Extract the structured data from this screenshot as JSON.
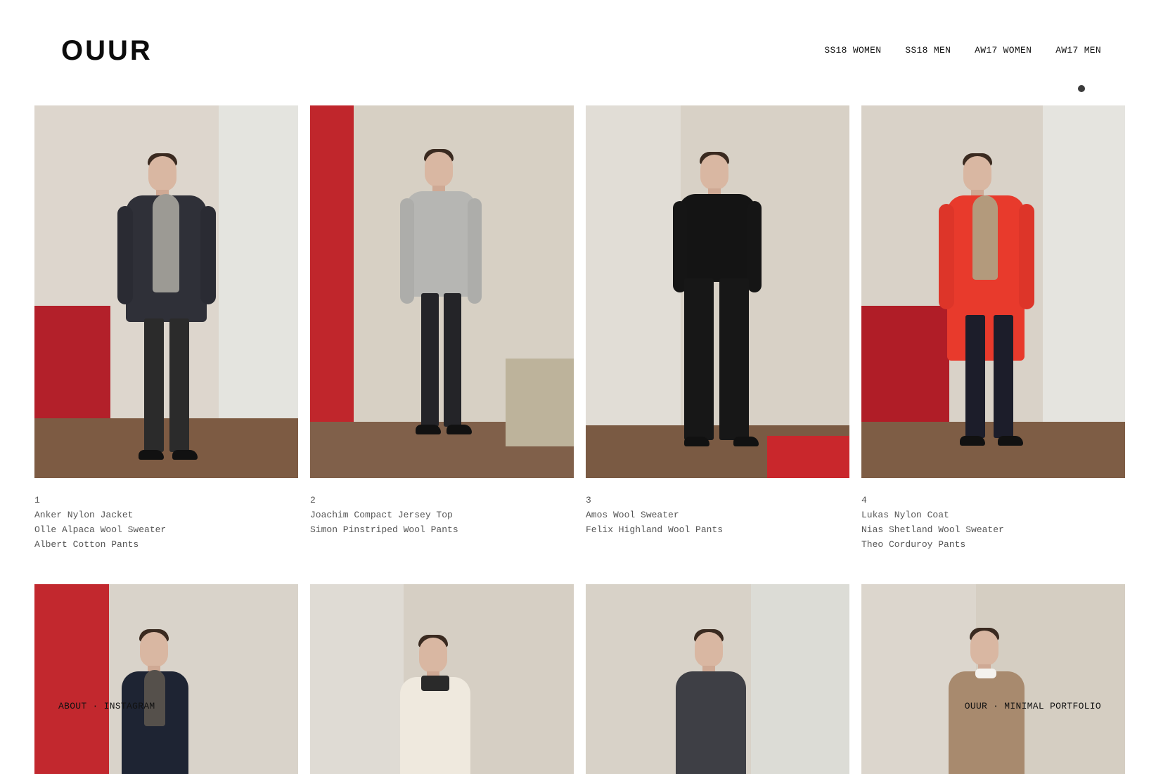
{
  "brand": {
    "logo": "OUUR"
  },
  "nav": [
    "SS18 WOMEN",
    "SS18 MEN",
    "AW17 WOMEN",
    "AW17 MEN"
  ],
  "looks": [
    {
      "number": "1",
      "items": [
        "Anker Nylon Jacket",
        "Olle Alpaca Wool Sweater",
        "Albert Cotton Pants"
      ]
    },
    {
      "number": "2",
      "items": [
        "Joachim Compact Jersey Top",
        "Simon Pinstriped Wool Pants"
      ]
    },
    {
      "number": "3",
      "items": [
        "Amos Wool Sweater",
        "Felix Highland Wool Pants"
      ]
    },
    {
      "number": "4",
      "items": [
        "Lukas Nylon Coat",
        "Nias Shetland Wool Sweater",
        "Theo Corduroy Pants"
      ]
    }
  ],
  "footer": {
    "about": "ABOUT",
    "separator": "·",
    "instagram": "INSTAGRAM",
    "site": "OUUR",
    "tagline": "MINIMAL PORTFOLIO"
  },
  "colors": {
    "accent_red": "#c0262c",
    "backdrop": "#d8d2c8",
    "floor": "#7d5b43"
  }
}
